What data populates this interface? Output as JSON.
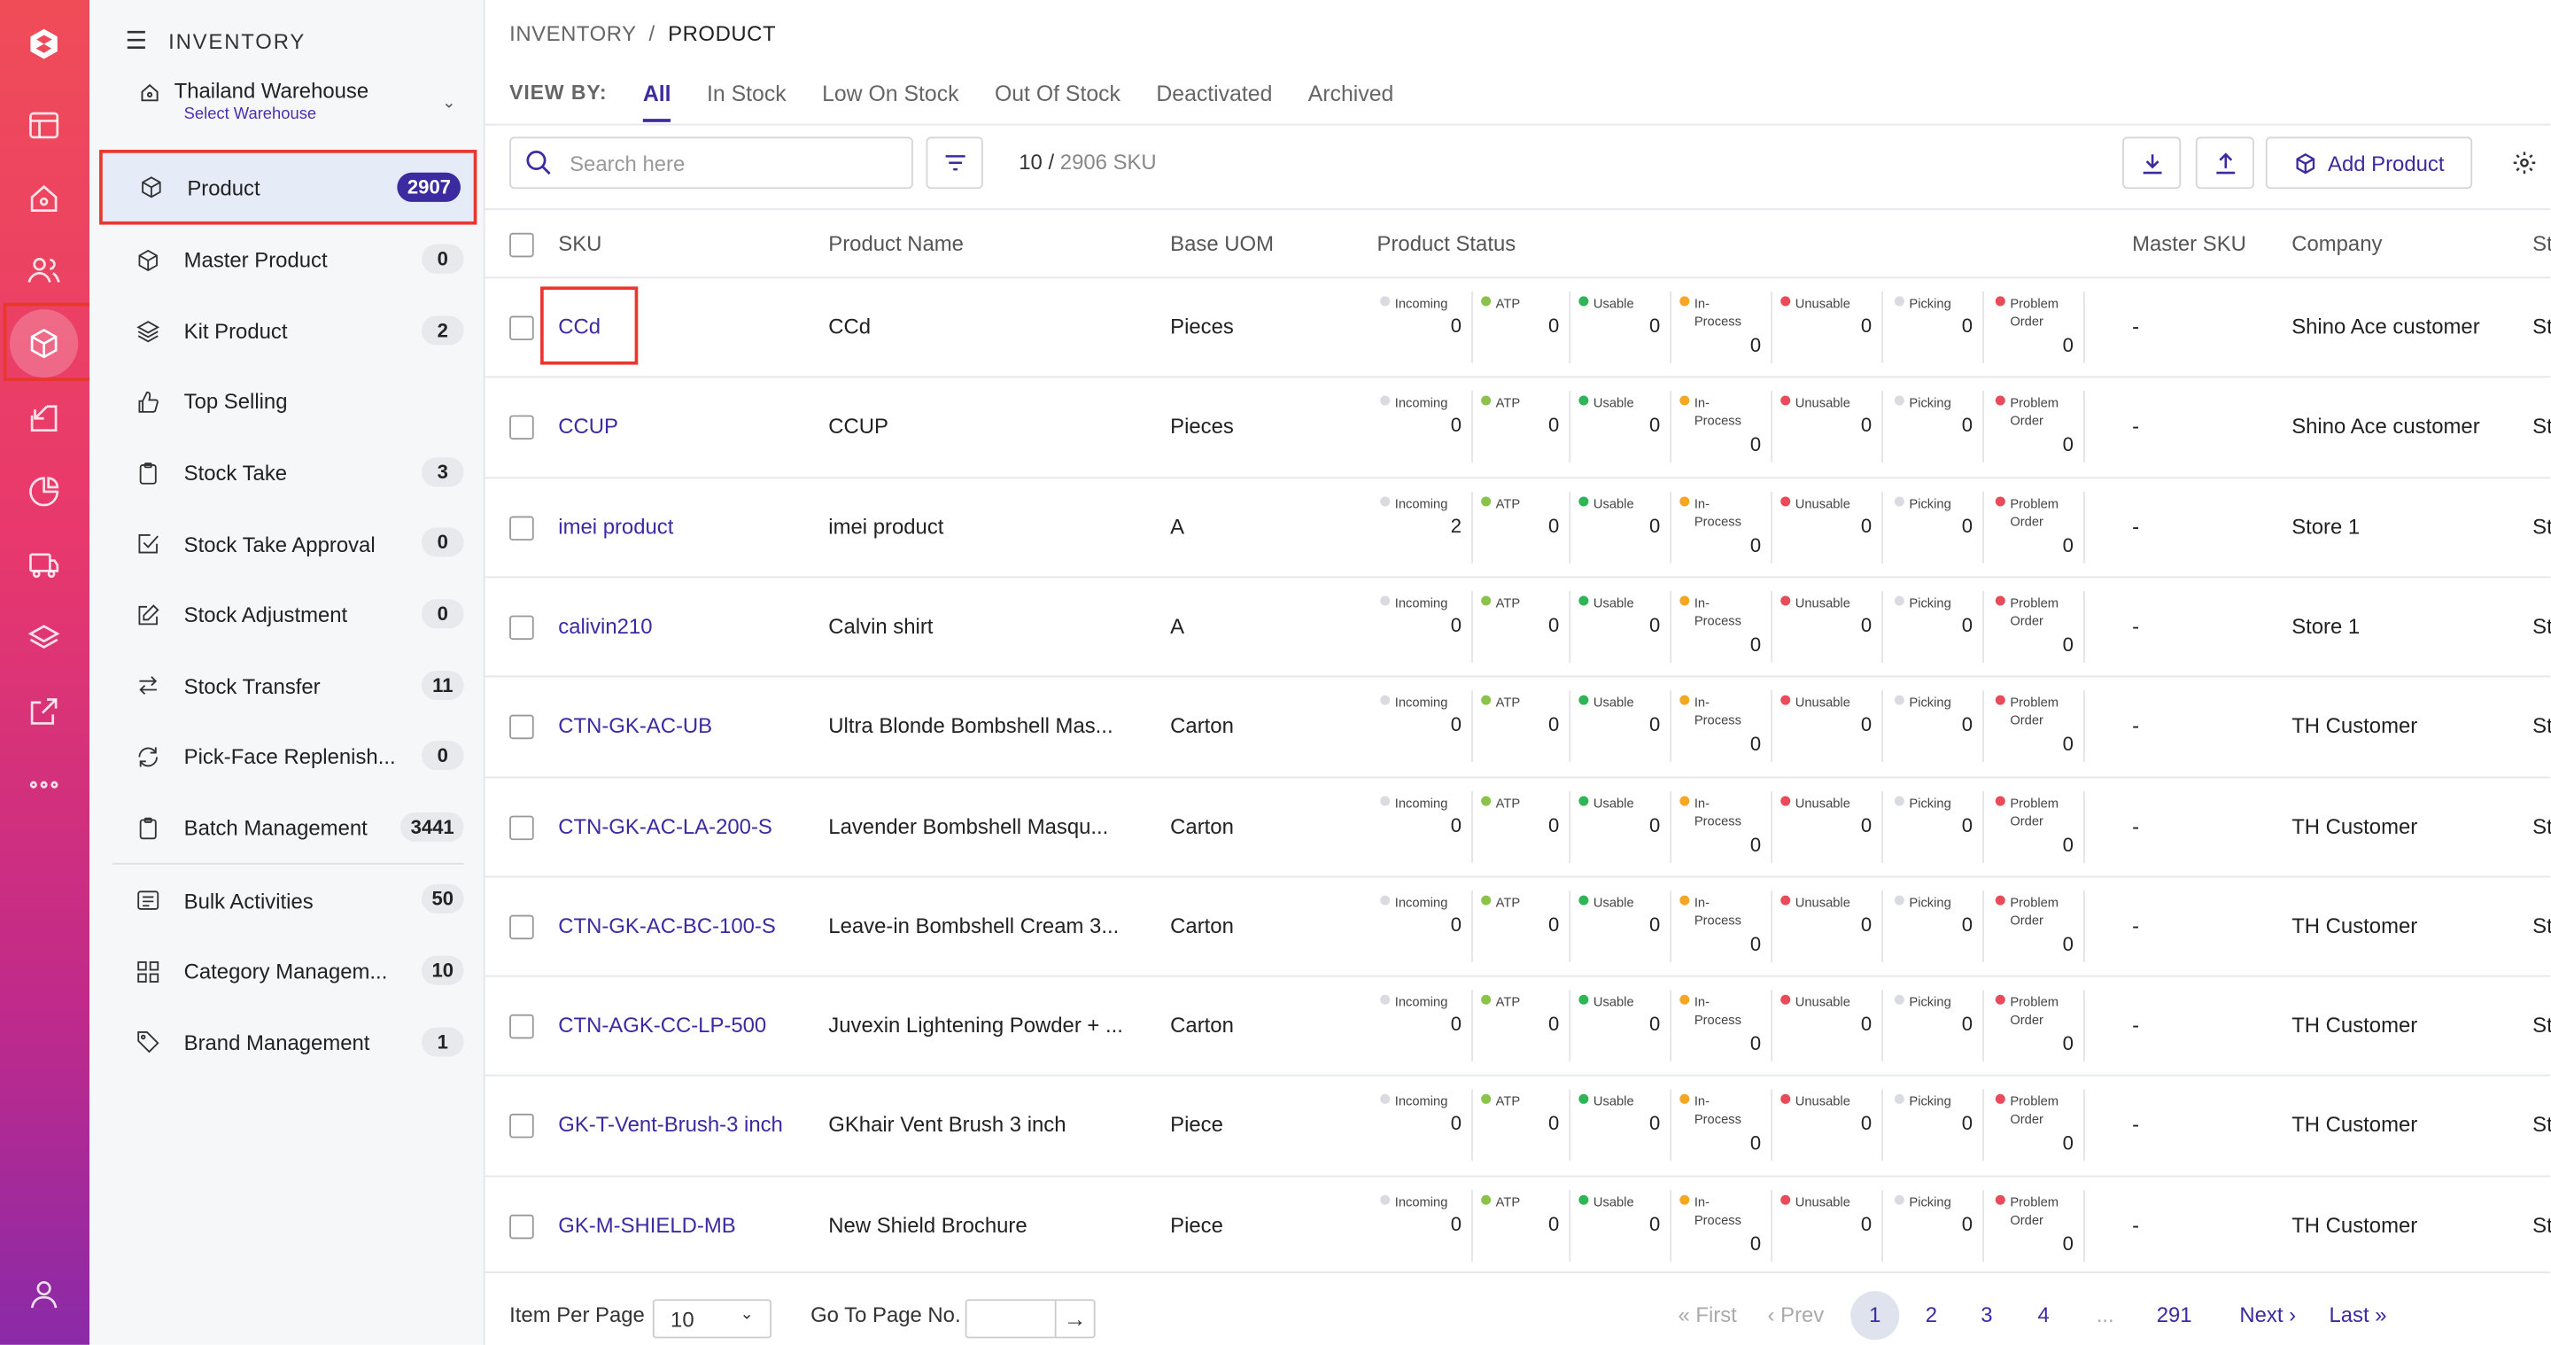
{
  "sidebar": {
    "header": "INVENTORY",
    "warehouse": {
      "name": "Thailand Warehouse",
      "sub": "Select Warehouse"
    },
    "items": [
      {
        "label": "Product",
        "count": "2907",
        "icon": "box-icon"
      },
      {
        "label": "Master Product",
        "count": "0",
        "icon": "box-icon"
      },
      {
        "label": "Kit Product",
        "count": "2",
        "icon": "layers-icon"
      },
      {
        "label": "Top Selling",
        "count": "",
        "icon": "thumbs-up-icon"
      },
      {
        "label": "Stock Take",
        "count": "3",
        "icon": "clipboard-icon"
      },
      {
        "label": "Stock Take Approval",
        "count": "0",
        "icon": "check-square-icon"
      },
      {
        "label": "Stock Adjustment",
        "count": "0",
        "icon": "edit-icon"
      },
      {
        "label": "Stock Transfer",
        "count": "11",
        "icon": "transfer-icon"
      },
      {
        "label": "Pick-Face Replenish...",
        "count": "0",
        "icon": "refresh-icon"
      },
      {
        "label": "Batch Management",
        "count": "3441",
        "icon": "clipboard-icon"
      },
      {
        "label": "Bulk Activities",
        "count": "50",
        "icon": "list-icon"
      },
      {
        "label": "Category Managem...",
        "count": "10",
        "icon": "grid-icon"
      },
      {
        "label": "Brand Management",
        "count": "1",
        "icon": "tag-icon"
      }
    ]
  },
  "breadcrumb": {
    "root": "INVENTORY",
    "sep": "/",
    "current": "PRODUCT"
  },
  "viewby": {
    "label": "VIEW BY:",
    "tabs": [
      "All",
      "In Stock",
      "Low On Stock",
      "Out Of Stock",
      "Deactivated",
      "Archived"
    ]
  },
  "toolbar": {
    "search_placeholder": "Search here",
    "count_shown": "10 /",
    "count_total": "2906 SKU",
    "add_label": "Add Product"
  },
  "columns": [
    "SKU",
    "Product Name",
    "Base UOM",
    "Product Status",
    "Master SKU",
    "Company",
    "St"
  ],
  "status_labels": {
    "incoming": "Incoming",
    "atp": "ATP",
    "usable": "Usable",
    "in_process_1": "In-",
    "in_process_2": "Process",
    "unusable": "Unusable",
    "picking": "Picking",
    "problem_1": "Problem",
    "problem_2": "Order"
  },
  "status_colors": {
    "incoming": "#d9dbe0",
    "atp": "#8bc34a",
    "usable": "#2fb457",
    "in_process": "#f5a623",
    "unusable": "#e84b5a",
    "picking": "#d9dbe0",
    "problem": "#e84b5a"
  },
  "rows": [
    {
      "sku": "CCd",
      "name": "CCd",
      "uom": "Pieces",
      "s": [
        "0",
        "0",
        "0",
        "0",
        "0",
        "0",
        "0"
      ],
      "master": "-",
      "company": "Shino Ace customer",
      "st": "St"
    },
    {
      "sku": "CCUP",
      "name": "CCUP",
      "uom": "Pieces",
      "s": [
        "0",
        "0",
        "0",
        "0",
        "0",
        "0",
        "0"
      ],
      "master": "-",
      "company": "Shino Ace customer",
      "st": "St"
    },
    {
      "sku": "imei product",
      "name": "imei product",
      "uom": "A",
      "s": [
        "2",
        "0",
        "0",
        "0",
        "0",
        "0",
        "0"
      ],
      "master": "-",
      "company": "Store 1",
      "st": "St"
    },
    {
      "sku": "calivin210",
      "name": "Calvin shirt",
      "uom": "A",
      "s": [
        "0",
        "0",
        "0",
        "0",
        "0",
        "0",
        "0"
      ],
      "master": "-",
      "company": "Store 1",
      "st": "St"
    },
    {
      "sku": "CTN-GK-AC-UB",
      "name": "Ultra Blonde Bombshell Mas...",
      "uom": "Carton",
      "s": [
        "0",
        "0",
        "0",
        "0",
        "0",
        "0",
        "0"
      ],
      "master": "-",
      "company": "TH Customer",
      "st": "St"
    },
    {
      "sku": "CTN-GK-AC-LA-200-S",
      "name": "Lavender Bombshell Masqu...",
      "uom": "Carton",
      "s": [
        "0",
        "0",
        "0",
        "0",
        "0",
        "0",
        "0"
      ],
      "master": "-",
      "company": "TH Customer",
      "st": "St"
    },
    {
      "sku": "CTN-GK-AC-BC-100-S",
      "name": "Leave-in Bombshell Cream 3...",
      "uom": "Carton",
      "s": [
        "0",
        "0",
        "0",
        "0",
        "0",
        "0",
        "0"
      ],
      "master": "-",
      "company": "TH Customer",
      "st": "St"
    },
    {
      "sku": "CTN-AGK-CC-LP-500",
      "name": "Juvexin Lightening Powder + ...",
      "uom": "Carton",
      "s": [
        "0",
        "0",
        "0",
        "0",
        "0",
        "0",
        "0"
      ],
      "master": "-",
      "company": "TH Customer",
      "st": "St"
    },
    {
      "sku": "GK-T-Vent-Brush-3 inch",
      "name": "GKhair Vent Brush 3 inch",
      "uom": "Piece",
      "s": [
        "0",
        "0",
        "0",
        "0",
        "0",
        "0",
        "0"
      ],
      "master": "-",
      "company": "TH Customer",
      "st": "St"
    },
    {
      "sku": "GK-M-SHIELD-MB",
      "name": "New Shield Brochure",
      "uom": "Piece",
      "s": [
        "0",
        "0",
        "0",
        "0",
        "0",
        "0",
        "0"
      ],
      "master": "-",
      "company": "TH Customer",
      "st": "St"
    }
  ],
  "footer": {
    "per_page_label": "Item Per Page",
    "per_page_value": "10",
    "goto_label": "Go To Page No.",
    "first": "First",
    "prev": "Prev",
    "pages": [
      "1",
      "2",
      "3",
      "4",
      "...",
      "291"
    ],
    "next": "Next",
    "last": "Last"
  }
}
